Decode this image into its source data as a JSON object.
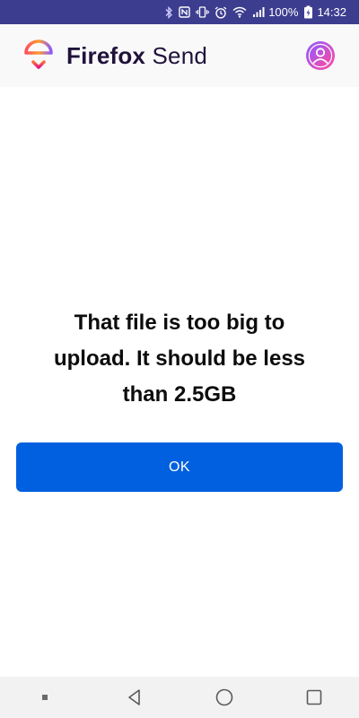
{
  "status_bar": {
    "battery_percent": "100%",
    "time": "14:32",
    "icons": [
      "bluetooth-icon",
      "nfc-icon",
      "vibrate-icon",
      "alarm-icon",
      "wifi-icon",
      "signal-icon",
      "battery-charging-icon"
    ]
  },
  "header": {
    "brand_bold": "Firefox",
    "brand_light": " Send",
    "logo_icon": "firefox-send-logo-icon",
    "avatar_icon": "user-avatar-icon"
  },
  "dialog": {
    "message": "That file is too big to upload. It should be less than 2.5GB",
    "ok_label": "OK"
  },
  "nav_bar": {
    "icons": [
      "recent-dot-icon",
      "back-icon",
      "home-icon",
      "overview-icon"
    ]
  },
  "colors": {
    "status_bar_bg": "#3c3d8f",
    "header_bg": "#f9f9fa",
    "primary_button": "#0060df",
    "text_dark": "#0c0c0d",
    "brand_text": "#20123a",
    "avatar_gradient_start": "#9059ff",
    "avatar_gradient_end": "#ff4aa2",
    "nav_bar_bg": "#f2f2f2"
  }
}
